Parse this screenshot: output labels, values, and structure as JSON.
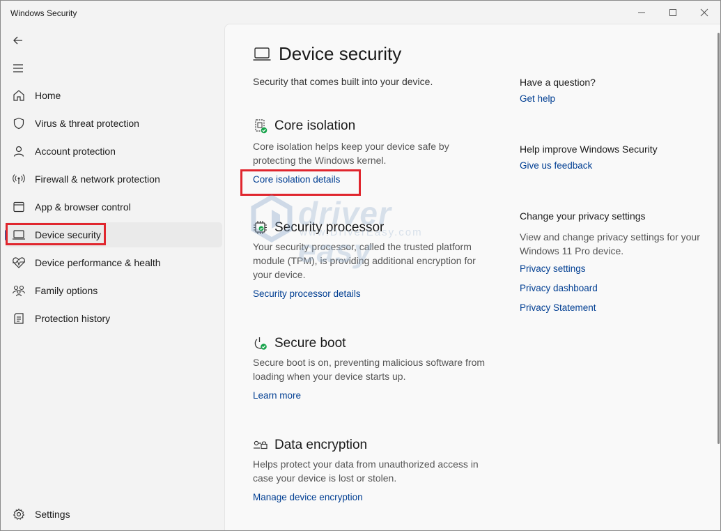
{
  "window": {
    "title": "Windows Security",
    "controls": {
      "minimize": "minimize-icon",
      "maximize": "maximize-icon",
      "close": "close-icon"
    }
  },
  "nav": {
    "back_icon": "back-arrow-icon",
    "menu_icon": "hamburger-menu-icon",
    "items": [
      {
        "label": "Home",
        "icon": "home-icon"
      },
      {
        "label": "Virus & threat protection",
        "icon": "shield-icon"
      },
      {
        "label": "Account protection",
        "icon": "person-icon"
      },
      {
        "label": "Firewall & network protection",
        "icon": "wifi-antenna-icon"
      },
      {
        "label": "App & browser control",
        "icon": "browser-window-icon"
      },
      {
        "label": "Device security",
        "icon": "laptop-icon",
        "selected": true
      },
      {
        "label": "Device performance & health",
        "icon": "heart-pulse-icon"
      },
      {
        "label": "Family options",
        "icon": "family-icon"
      },
      {
        "label": "Protection history",
        "icon": "history-icon"
      }
    ],
    "settings_label": "Settings"
  },
  "main": {
    "title": "Device security",
    "subtitle": "Security that comes built into your device.",
    "sections": [
      {
        "title": "Core isolation",
        "description": "Core isolation helps keep your device safe by protecting the Windows kernel.",
        "link": "Core isolation details",
        "icon": "chip-check-icon"
      },
      {
        "title": "Security processor",
        "description": "Your security processor, called the trusted platform module (TPM), is providing additional encryption for your device.",
        "link": "Security processor details",
        "icon": "processor-chip-icon"
      },
      {
        "title": "Secure boot",
        "description": "Secure boot is on, preventing malicious software from loading when your device starts up.",
        "link": "Learn more",
        "icon": "power-check-icon"
      },
      {
        "title": "Data encryption",
        "description": "Helps protect your data from unauthorized access in case your device is lost or stolen.",
        "link": "Manage device encryption",
        "icon": "key-lock-icon"
      }
    ]
  },
  "side": {
    "question_title": "Have a question?",
    "get_help": "Get help",
    "improve_title": "Help improve Windows Security",
    "feedback": "Give us feedback",
    "privacy_title": "Change your privacy settings",
    "privacy_desc": "View and change privacy settings for your Windows 11 Pro device.",
    "privacy_links": [
      "Privacy settings",
      "Privacy dashboard",
      "Privacy Statement"
    ]
  },
  "watermark": {
    "text": "driver easy",
    "sub": "www.DriverEasy.com"
  },
  "colors": {
    "accent": "#005fb8",
    "link": "#003e92",
    "highlight": "#e0262e",
    "check": "#16a34a"
  }
}
